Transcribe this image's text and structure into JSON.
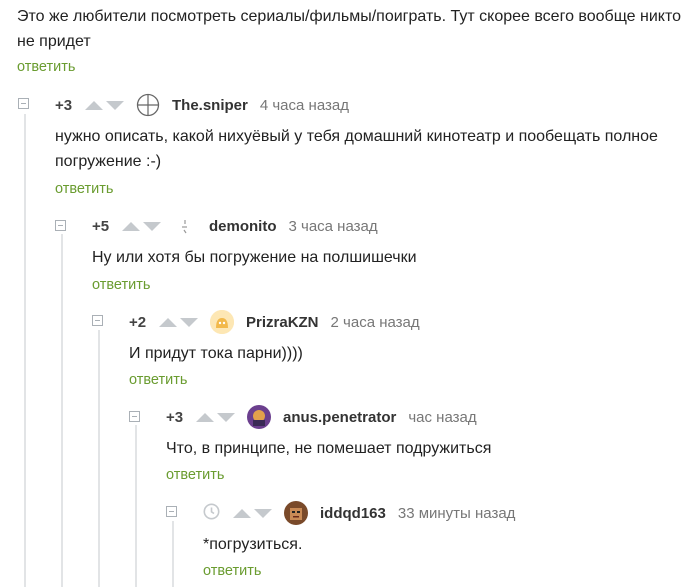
{
  "top": {
    "text": "Это же любители посмотреть сериалы/фильмы/поиграть. Тут скорее всего вообще никто не придет",
    "reply_label": "ответить"
  },
  "comments": [
    {
      "score": "+3",
      "user": "The.sniper",
      "time": "4 часа назад",
      "text": "нужно описать, какой нихуёвый у тебя домашний кинотеатр и пообещать полное погружение :-)",
      "reply_label": "ответить"
    },
    {
      "score": "+5",
      "user": "demonito",
      "time": "3 часа назад",
      "text": "Ну или хотя бы погружение на полшишечки",
      "reply_label": "ответить"
    },
    {
      "score": "+2",
      "user": "PrizraKZN",
      "time": "2 часа назад",
      "text": "И придут тока парни))))",
      "reply_label": "ответить"
    },
    {
      "score": "+3",
      "user": "anus.penetrator",
      "time": "час назад",
      "text": "Что, в принципе, не помешает подружиться",
      "reply_label": "ответить"
    },
    {
      "score": "",
      "user": "iddqd163",
      "time": "33 минуты назад",
      "text": "*погрузиться.",
      "reply_label": "ответить"
    }
  ],
  "icons": {
    "vote_up": "arrow-up-icon",
    "vote_down": "arrow-down-icon",
    "collapse": "minus-square-icon",
    "pending_score": "clock-icon"
  },
  "colors": {
    "reply_link": "#6a9c30",
    "arrows": "#c5c9cd",
    "thread_line": "#e2e4e6"
  }
}
